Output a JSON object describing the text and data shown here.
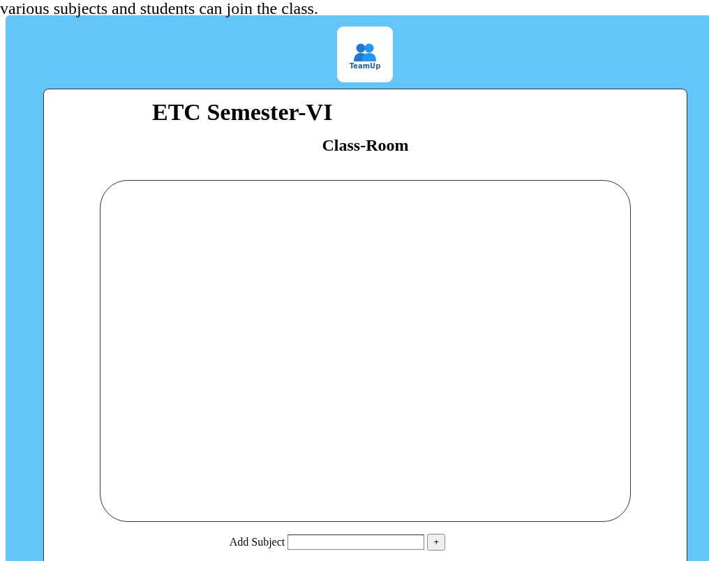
{
  "intro_text": "various subjects and students can join the class.",
  "logo": {
    "text": "TeamUp"
  },
  "class": {
    "title": "ETC Semester-VI",
    "heading": "Class-Room"
  },
  "add_subject": {
    "label": "Add Subject",
    "button": "+"
  }
}
